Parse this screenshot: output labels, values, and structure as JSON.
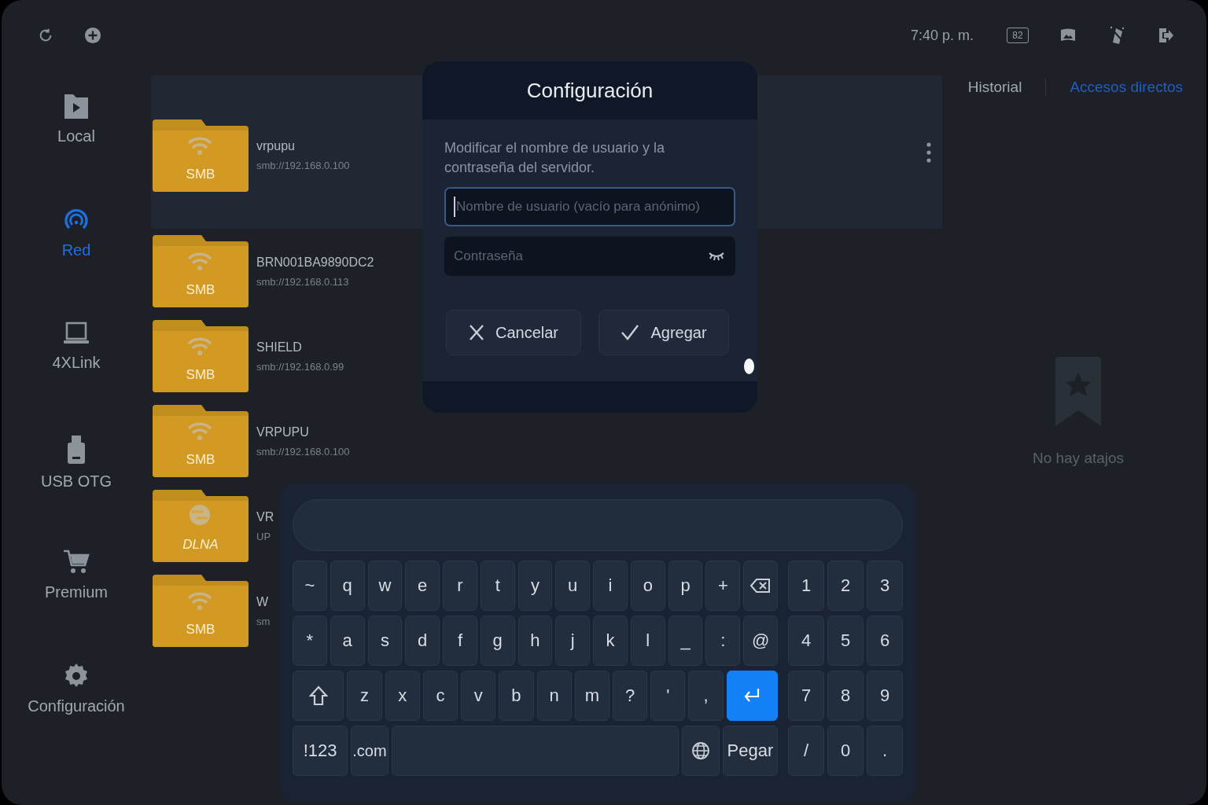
{
  "top_bar": {
    "left_icons": [
      {
        "kind": "refresh"
      },
      {
        "kind": "add"
      }
    ],
    "time": "7:40 p. m.",
    "battery": "82",
    "right_icons": [
      {
        "kind": "panorama"
      },
      {
        "kind": "effects"
      },
      {
        "kind": "exit"
      }
    ]
  },
  "sidebar": {
    "items": [
      {
        "kind": "local",
        "label": "Local",
        "selected": false
      },
      {
        "kind": "network",
        "label": "Red",
        "selected": true
      },
      {
        "kind": "laptop",
        "label": "4XLink",
        "selected": false
      },
      {
        "kind": "usb",
        "label": "USB OTG",
        "selected": false
      },
      {
        "kind": "cart",
        "label": "Premium",
        "selected": false
      },
      {
        "kind": "gear",
        "label": "Configuración",
        "selected": false
      }
    ]
  },
  "servers": [
    {
      "kind": "smb",
      "badge": "SMB",
      "name": "vrpupu",
      "address": "smb://192.168.0.100",
      "selected": true
    },
    {
      "kind": "smb",
      "badge": "SMB",
      "name": "BRN001BA9890DC2",
      "address": "smb://192.168.0.113",
      "selected": false
    },
    {
      "kind": "smb",
      "badge": "SMB",
      "name": "SHIELD",
      "address": "smb://192.168.0.99",
      "selected": false
    },
    {
      "kind": "smb",
      "badge": "SMB",
      "name": "VRPUPU",
      "address": "smb://192.168.0.100",
      "selected": false
    },
    {
      "kind": "dlna",
      "badge": "DLNA",
      "name": "VR",
      "address": "UP",
      "selected": false
    },
    {
      "kind": "smb",
      "badge": "SMB",
      "name": "W",
      "address": "sm",
      "selected": false
    }
  ],
  "shortcuts": {
    "tabs": [
      {
        "label": "Historial",
        "selected": false
      },
      {
        "label": "Accesos directos",
        "selected": true
      }
    ],
    "empty_message": "No hay atajos"
  },
  "dialog": {
    "title": "Configuración",
    "description": "Modificar el nombre de usuario y la contraseña del servidor.",
    "fields": [
      {
        "kind": "text",
        "placeholder": "Nombre de usuario (vacío para anónimo)",
        "focused": true
      },
      {
        "kind": "password",
        "placeholder": "Contraseña",
        "focused": false
      }
    ],
    "buttons": [
      {
        "kind": "cancel",
        "label": "Cancelar"
      },
      {
        "kind": "confirm",
        "label": "Agregar"
      }
    ]
  },
  "keyboard": {
    "number_row": [
      {
        "kind": "char",
        "label": "~",
        "focused": false
      },
      {
        "kind": "char",
        "label": "q",
        "focused": false
      },
      {
        "kind": "char",
        "label": "w",
        "focused": false
      },
      {
        "kind": "char",
        "label": "e",
        "focused": false
      },
      {
        "kind": "char",
        "label": "r",
        "focused": false
      },
      {
        "kind": "char",
        "label": "t",
        "focused": false
      },
      {
        "kind": "char",
        "label": "y",
        "focused": false
      },
      {
        "kind": "char",
        "label": "u",
        "focused": false
      },
      {
        "kind": "char",
        "label": "i",
        "focused": false
      },
      {
        "kind": "char",
        "label": "o",
        "focused": false
      },
      {
        "kind": "char",
        "label": "p",
        "focused": false
      },
      {
        "kind": "char",
        "label": "+",
        "focused": false
      },
      {
        "kind": "backspace",
        "focused": false
      }
    ],
    "home_row": [
      {
        "kind": "char",
        "label": "*",
        "focused": false
      },
      {
        "kind": "char",
        "label": "a",
        "focused": false
      },
      {
        "kind": "char",
        "label": "s",
        "focused": false
      },
      {
        "kind": "char",
        "label": "d",
        "focused": false
      },
      {
        "kind": "char",
        "label": "f",
        "focused": false
      },
      {
        "kind": "char",
        "label": "g",
        "focused": false
      },
      {
        "kind": "char",
        "label": "h",
        "focused": false
      },
      {
        "kind": "char",
        "label": "j",
        "focused": false
      },
      {
        "kind": "char",
        "label": "k",
        "focused": false
      },
      {
        "kind": "char",
        "label": "l",
        "focused": false
      },
      {
        "kind": "char",
        "label": "_",
        "focused": false
      },
      {
        "kind": "char",
        "label": ":",
        "focused": false
      },
      {
        "kind": "char",
        "label": "@",
        "focused": false
      }
    ],
    "bottom_row": [
      {
        "kind": "shift",
        "focused": false
      },
      {
        "kind": "char",
        "label": "z",
        "focused": false
      },
      {
        "kind": "char",
        "label": "x",
        "focused": false
      },
      {
        "kind": "char",
        "label": "c",
        "focused": false
      },
      {
        "kind": "char",
        "label": "v",
        "focused": false
      },
      {
        "kind": "char",
        "label": "b",
        "focused": false
      },
      {
        "kind": "char",
        "label": "n",
        "focused": false
      },
      {
        "kind": "char",
        "label": "m",
        "focused": false
      },
      {
        "kind": "char",
        "label": "?",
        "focused": false
      },
      {
        "kind": "char",
        "label": "'",
        "focused": false
      },
      {
        "kind": "char",
        "label": ",",
        "focused": false
      },
      {
        "kind": "enter",
        "focused": true
      }
    ],
    "space_row": [
      {
        "kind": "wide",
        "label": "!123",
        "focused": false
      },
      {
        "kind": "char",
        "label": ".com",
        "focused": false
      },
      {
        "kind": "space",
        "focused": false
      },
      {
        "kind": "globe",
        "focused": false
      },
      {
        "kind": "wide",
        "label": "Pegar",
        "focused": false
      }
    ],
    "numpad": [
      [
        "1",
        "2",
        "3"
      ],
      [
        "4",
        "5",
        "6"
      ],
      [
        "7",
        "8",
        "9"
      ],
      [
        "/",
        "0",
        "."
      ]
    ]
  }
}
